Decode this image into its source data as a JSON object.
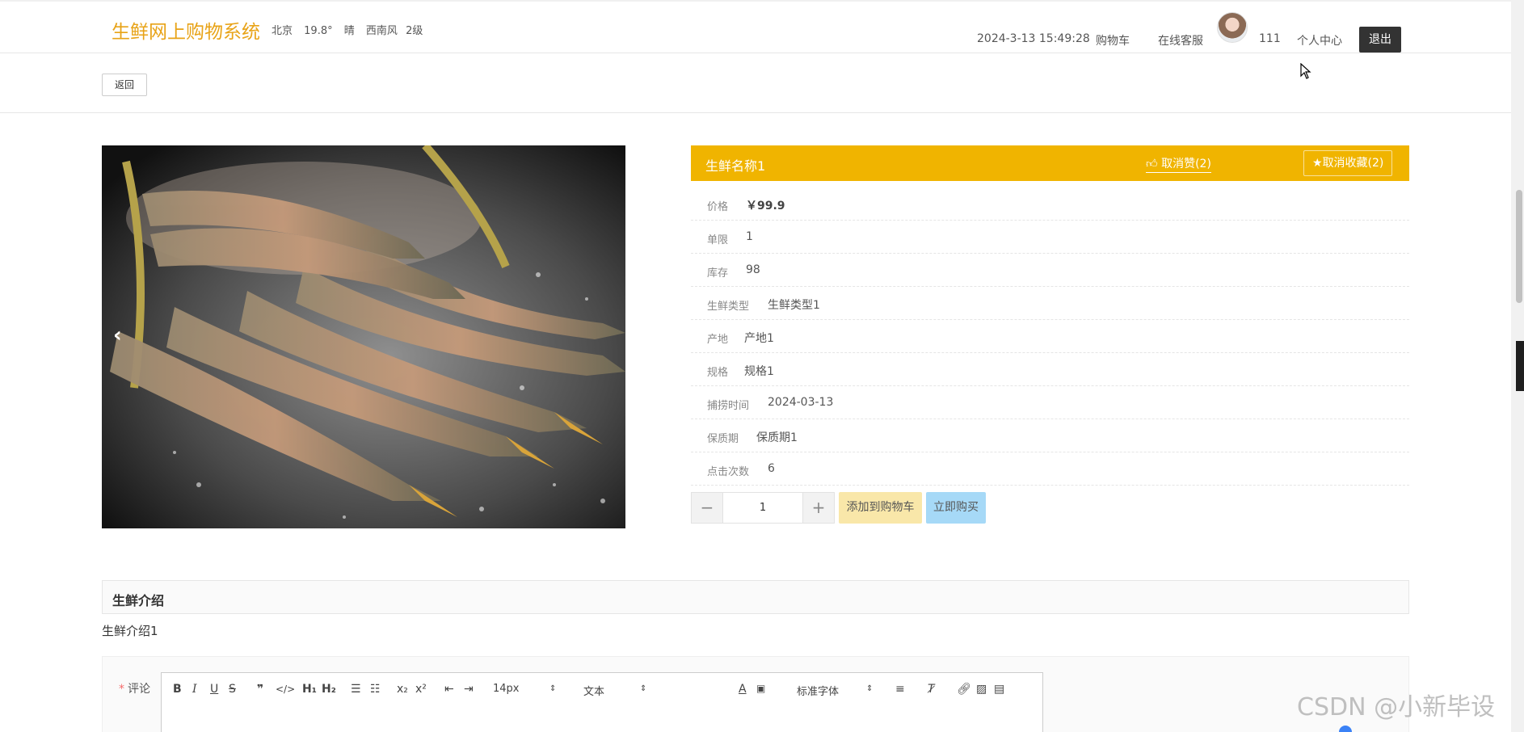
{
  "header": {
    "brand": "生鲜网上购物系统",
    "weather": {
      "city": "北京",
      "temp": "19.8°",
      "condition": "晴",
      "wind_dir": "西南风",
      "wind_level": "2级"
    },
    "datetime": "2024-3-13 15:49:28",
    "cart_label": "购物车",
    "service_label": "在线客服",
    "username": "111",
    "profile_label": "个人中心",
    "logout_label": "退出"
  },
  "back_label": "返回",
  "product": {
    "name": "生鲜名称1",
    "like_label": "取消赞(2)",
    "fav_label": "取消收藏(2)",
    "attributes": [
      {
        "label": "价格",
        "value": "￥99.9"
      },
      {
        "label": "单限",
        "value": "1"
      },
      {
        "label": "库存",
        "value": "98"
      },
      {
        "label": "生鲜类型",
        "value": "生鲜类型1"
      },
      {
        "label": "产地",
        "value": "产地1"
      },
      {
        "label": "规格",
        "value": "规格1"
      },
      {
        "label": "捕捞时间",
        "value": "2024-03-13"
      },
      {
        "label": "保质期",
        "value": "保质期1"
      },
      {
        "label": "点击次数",
        "value": "6"
      }
    ],
    "quantity": "1",
    "add_cart_label": "添加到购物车",
    "buy_now_label": "立即购买"
  },
  "intro": {
    "heading": "生鲜介绍",
    "text": "生鲜介绍1"
  },
  "comment": {
    "required_mark": "*",
    "label": "评论",
    "toolbar": {
      "font_size": "14px",
      "text_style": "文本",
      "font_family": "标准字体"
    }
  },
  "watermark": "CSDN @小新毕设",
  "colors": {
    "accent": "#f0b400",
    "brand": "#e8a317",
    "cart": "#f9e7a9",
    "buy": "#a6d9f7"
  }
}
